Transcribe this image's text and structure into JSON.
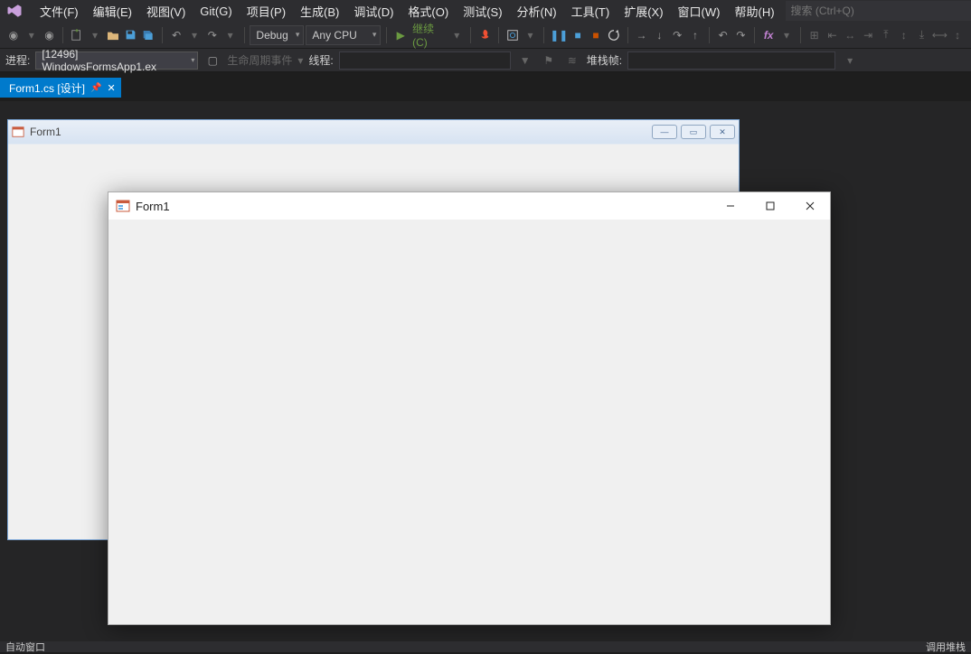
{
  "menu": {
    "file": "文件(F)",
    "edit": "编辑(E)",
    "view": "视图(V)",
    "git": "Git(G)",
    "project": "项目(P)",
    "build": "生成(B)",
    "debug": "调试(D)",
    "format": "格式(O)",
    "test": "测试(S)",
    "analyze": "分析(N)",
    "tools": "工具(T)",
    "extensions": "扩展(X)",
    "window": "窗口(W)",
    "help": "帮助(H)"
  },
  "search": {
    "placeholder": "搜索 (Ctrl+Q)"
  },
  "toolbar": {
    "config": "Debug",
    "platform": "Any CPU",
    "continue": "继续(C)"
  },
  "process": {
    "label": "进程:",
    "value": "[12496] WindowsFormsApp1.ex",
    "lifecycle": "生命周期事件",
    "thread": "线程:",
    "stackframe": "堆栈帧:"
  },
  "tab": {
    "title": "Form1.cs [设计]"
  },
  "designerForm": {
    "title": "Form1"
  },
  "runWindow": {
    "title": "Form1"
  },
  "bottom": {
    "left": "自动窗口",
    "right": "调用堆栈"
  }
}
